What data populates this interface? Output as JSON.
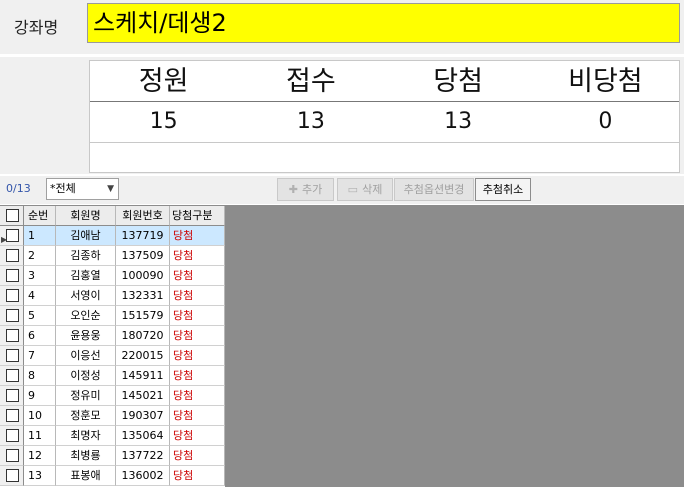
{
  "course": {
    "label": "강좌명",
    "name": "스케치/데생2"
  },
  "stats": {
    "headers": [
      "정원",
      "접수",
      "당첨",
      "비당첨"
    ],
    "values": [
      "15",
      "13",
      "13",
      "0"
    ]
  },
  "toolbar": {
    "count": "0/13",
    "filter_value": "*전체",
    "add_label": "추가",
    "delete_label": "삭제",
    "option_change_label": "추첨옵션변경",
    "cancel_draw_label": "추첨취소"
  },
  "grid": {
    "columns": [
      "순번",
      "회원명",
      "회원번호",
      "당첨구분"
    ],
    "rows": [
      {
        "no": "1",
        "name": "김애남",
        "id": "137719",
        "result": "당첨"
      },
      {
        "no": "2",
        "name": "김종하",
        "id": "137509",
        "result": "당첨"
      },
      {
        "no": "3",
        "name": "김홍열",
        "id": "100090",
        "result": "당첨"
      },
      {
        "no": "4",
        "name": "서영이",
        "id": "132331",
        "result": "당첨"
      },
      {
        "no": "5",
        "name": "오인순",
        "id": "151579",
        "result": "당첨"
      },
      {
        "no": "6",
        "name": "윤용웅",
        "id": "180720",
        "result": "당첨"
      },
      {
        "no": "7",
        "name": "이응선",
        "id": "220015",
        "result": "당첨"
      },
      {
        "no": "8",
        "name": "이정성",
        "id": "145911",
        "result": "당첨"
      },
      {
        "no": "9",
        "name": "정유미",
        "id": "145021",
        "result": "당첨"
      },
      {
        "no": "10",
        "name": "정훈모",
        "id": "190307",
        "result": "당첨"
      },
      {
        "no": "11",
        "name": "최명자",
        "id": "135064",
        "result": "당첨"
      },
      {
        "no": "12",
        "name": "최병룡",
        "id": "137722",
        "result": "당첨"
      },
      {
        "no": "13",
        "name": "표봉애",
        "id": "136002",
        "result": "당첨"
      }
    ]
  }
}
